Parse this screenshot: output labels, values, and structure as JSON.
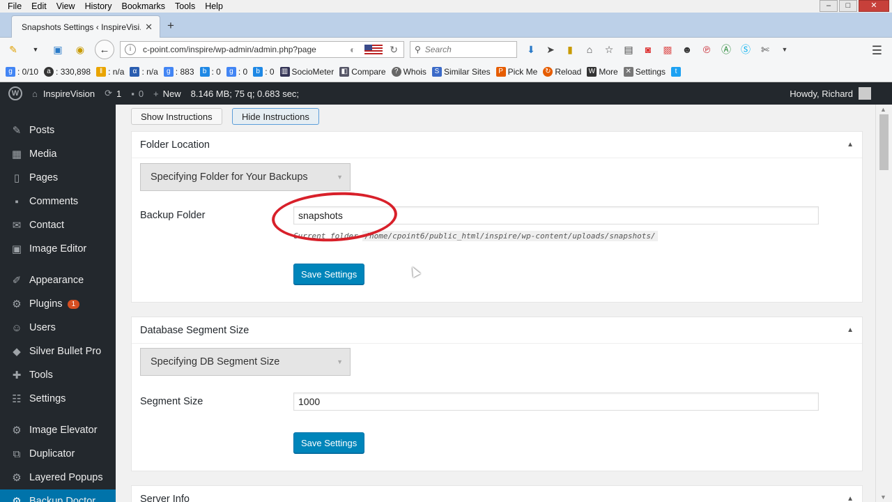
{
  "menubar": [
    "File",
    "Edit",
    "View",
    "History",
    "Bookmarks",
    "Tools",
    "Help"
  ],
  "tab": {
    "title": "Snapshots Settings ‹ InspireVisi..."
  },
  "address": {
    "url": "c-point.com/inspire/wp-admin/admin.php?page"
  },
  "search": {
    "placeholder": "Search"
  },
  "bookmarks": [
    {
      "label": ": 0/10",
      "icon": "google-pagerank-icon",
      "color": "#4285f4"
    },
    {
      "label": ": 330,898",
      "icon": "alexa-icon",
      "color": "#333"
    },
    {
      "label": ": n/a",
      "icon": "stats-icon",
      "color": "#e9a400"
    },
    {
      "label": ": n/a",
      "icon": "alpha-icon",
      "color": "#2a5db0"
    },
    {
      "label": ": 883",
      "icon": "google-icon",
      "color": "#4285f4"
    },
    {
      "label": ": 0",
      "icon": "bing-icon",
      "color": "#1e88e5"
    },
    {
      "label": ": 0",
      "icon": "google-icon",
      "color": "#4285f4"
    },
    {
      "label": ": 0",
      "icon": "bing-icon",
      "color": "#1e88e5"
    },
    {
      "label": "SocioMeter",
      "icon": "chart-icon",
      "color": "#335"
    },
    {
      "label": "Compare",
      "icon": "compare-icon",
      "color": "#556"
    },
    {
      "label": "Whois",
      "icon": "question-icon",
      "color": "#666"
    },
    {
      "label": "Similar Sites",
      "icon": "similar-icon",
      "color": "#3b6ac8"
    },
    {
      "label": "Pick Me",
      "icon": "pick-icon",
      "color": "#e65c00"
    },
    {
      "label": "Reload",
      "icon": "reload-icon",
      "color": "#e65c00"
    },
    {
      "label": "More",
      "icon": "wr-icon",
      "color": "#333"
    },
    {
      "label": "Settings",
      "icon": "wrench-icon",
      "color": "#555"
    }
  ],
  "adminbar": {
    "site": "InspireVision",
    "updates": "1",
    "comments": "0",
    "new": "New",
    "stats": "8.146 MB; 75 q; 0.683 sec;",
    "howdy": "Howdy, Richard"
  },
  "sidebar": [
    {
      "label": "Posts",
      "icon": "pin-icon"
    },
    {
      "label": "Media",
      "icon": "media-icon"
    },
    {
      "label": "Pages",
      "icon": "pages-icon"
    },
    {
      "label": "Comments",
      "icon": "comment-icon"
    },
    {
      "label": "Contact",
      "icon": "mail-icon"
    },
    {
      "label": "Image Editor",
      "icon": "image-icon"
    },
    {
      "label": "Appearance",
      "icon": "brush-icon"
    },
    {
      "label": "Plugins",
      "icon": "plugin-icon",
      "badge": "1"
    },
    {
      "label": "Users",
      "icon": "users-icon"
    },
    {
      "label": "Silver Bullet Pro",
      "icon": "shield-icon"
    },
    {
      "label": "Tools",
      "icon": "wrench-icon"
    },
    {
      "label": "Settings",
      "icon": "settings-icon"
    },
    {
      "label": "Image Elevator",
      "icon": "elevator-icon"
    },
    {
      "label": "Duplicator",
      "icon": "duplicator-icon"
    },
    {
      "label": "Layered Popups",
      "icon": "layers-icon"
    },
    {
      "label": "Backup Doctor",
      "icon": "backup-icon",
      "current": true
    }
  ],
  "buttons": {
    "show": "Show Instructions",
    "hide": "Hide Instructions"
  },
  "folder_box": {
    "title": "Folder Location",
    "accordion": "Specifying Folder for Your Backups",
    "label": "Backup Folder",
    "value": "snapshots",
    "hint_prefix": "Current folder",
    "hint_path": "/home/cpoint6/public_html/inspire/wp-content/uploads/snapshots/",
    "save": "Save Settings"
  },
  "db_box": {
    "title": "Database Segment Size",
    "accordion": "Specifying DB Segment Size",
    "label": "Segment Size",
    "value": "1000",
    "save": "Save Settings"
  },
  "server_box": {
    "title": "Server Info"
  }
}
